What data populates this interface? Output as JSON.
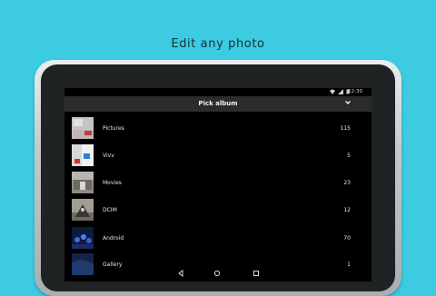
{
  "headline": "Edit any photo",
  "status": {
    "time": "12:30"
  },
  "action_bar": {
    "title": "Pick album"
  },
  "albums": [
    {
      "name": "Pictures",
      "count": "115"
    },
    {
      "name": "Vivv",
      "count": "5"
    },
    {
      "name": "Movies",
      "count": "23"
    },
    {
      "name": "DCIM",
      "count": "12"
    },
    {
      "name": "Android",
      "count": "70"
    },
    {
      "name": "Gallery",
      "count": "1"
    }
  ],
  "colors": {
    "background": "#3ccbe0",
    "screen": "#000000",
    "action_bar": "#2a2c2e"
  },
  "icons": [
    "chevron-down-icon",
    "back-icon",
    "home-icon",
    "recents-icon",
    "wifi-icon",
    "signal-icon",
    "battery-icon"
  ]
}
